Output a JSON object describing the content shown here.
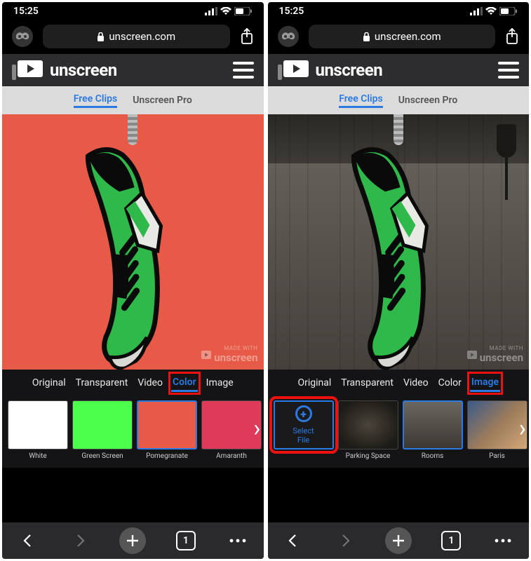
{
  "status": {
    "time": "15:25"
  },
  "browser": {
    "domain": "unscreen.com",
    "tabCount": "1"
  },
  "header": {
    "brand": "unscreen"
  },
  "nav": {
    "freeClips": "Free Clips",
    "pro": "Unscreen Pro"
  },
  "watermark": {
    "made": "MADE WITH",
    "brand": "unscreen"
  },
  "modes": {
    "original": "Original",
    "transparent": "Transparent",
    "video": "Video",
    "color": "Color",
    "image": "Image"
  },
  "left": {
    "swatches": [
      {
        "label": "White",
        "color": "#ffffff"
      },
      {
        "label": "Green Screen",
        "color": "#4cff4c"
      },
      {
        "label": "Pomegranate",
        "color": "#e75a47"
      },
      {
        "label": "Amaranth",
        "color": "#e03a5b"
      }
    ]
  },
  "right": {
    "selectFile": "Select\nFile",
    "thumbs": [
      {
        "label": "Parking Space"
      },
      {
        "label": "Rooms"
      },
      {
        "label": "Paris"
      }
    ]
  }
}
